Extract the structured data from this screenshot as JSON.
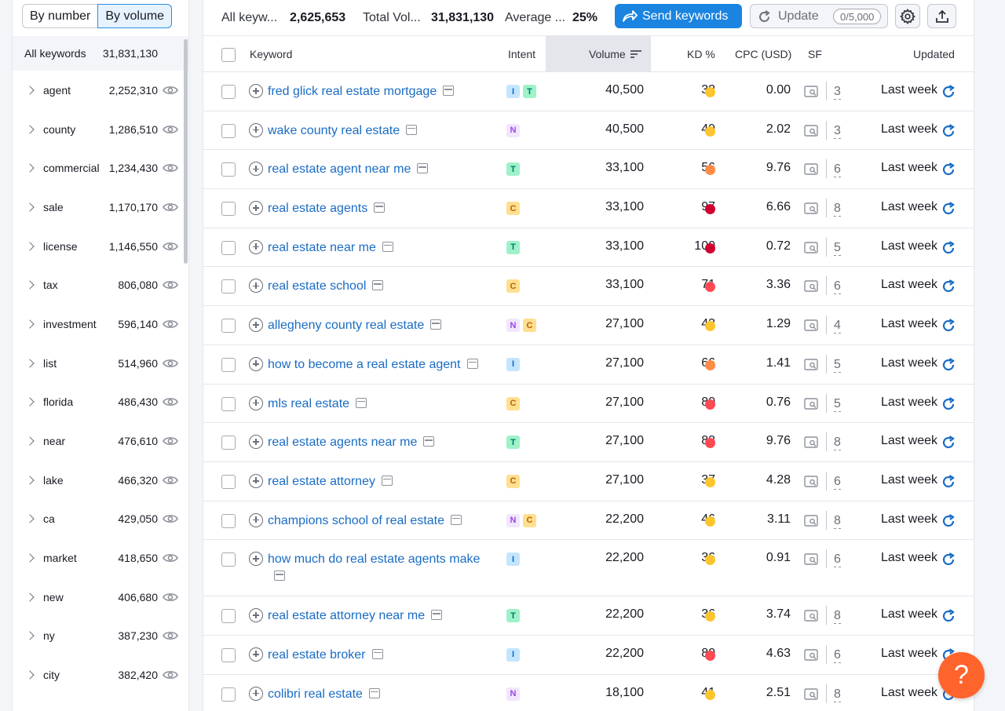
{
  "toggle": {
    "by_number": "By number",
    "by_volume": "By volume",
    "selected": "By volume"
  },
  "sidebar": {
    "all_label": "All keywords",
    "all_count": "31,831,130",
    "items": [
      {
        "name": "agent",
        "count": "2,252,310"
      },
      {
        "name": "county",
        "count": "1,286,510"
      },
      {
        "name": "commercial",
        "count": "1,234,430"
      },
      {
        "name": "sale",
        "count": "1,170,170"
      },
      {
        "name": "license",
        "count": "1,146,550"
      },
      {
        "name": "tax",
        "count": "806,080"
      },
      {
        "name": "investment",
        "count": "596,140"
      },
      {
        "name": "list",
        "count": "514,960"
      },
      {
        "name": "florida",
        "count": "486,430"
      },
      {
        "name": "near",
        "count": "476,610"
      },
      {
        "name": "lake",
        "count": "466,320"
      },
      {
        "name": "ca",
        "count": "429,050"
      },
      {
        "name": "market",
        "count": "418,650"
      },
      {
        "name": "new",
        "count": "406,680"
      },
      {
        "name": "ny",
        "count": "387,230"
      },
      {
        "name": "city",
        "count": "382,420"
      }
    ]
  },
  "topbar": {
    "all_kw_label": "All keyw...",
    "all_kw_value": "2,625,653",
    "total_vol_label": "Total Vol...",
    "total_vol_value": "31,831,130",
    "average_label": "Average ...",
    "average_value": "25%",
    "send_label": "Send keywords",
    "update_label": "Update",
    "update_quota": "0/5,000"
  },
  "columns": {
    "keyword": "Keyword",
    "intent": "Intent",
    "volume": "Volume",
    "kd": "KD %",
    "cpc": "CPC (USD)",
    "sf": "SF",
    "updated": "Updated"
  },
  "colors": {
    "kd_yellow": "#fcc52d",
    "kd_orange": "#ff8c43",
    "kd_red": "#ff4953",
    "kd_darkred": "#d1002f",
    "accent": "#1a84e0",
    "help": "#ff642d"
  },
  "rows": [
    {
      "keyword": "fred glick real estate mortgage",
      "intents": [
        "I",
        "T"
      ],
      "volume": "40,500",
      "kd": "32",
      "kd_color": "#fcc52d",
      "cpc": "0.00",
      "sf": "3",
      "updated": "Last week"
    },
    {
      "keyword": "wake county real estate",
      "intents": [
        "N"
      ],
      "volume": "40,500",
      "kd": "49",
      "kd_color": "#fcc52d",
      "cpc": "2.02",
      "sf": "3",
      "updated": "Last week"
    },
    {
      "keyword": "real estate agent near me",
      "intents": [
        "T"
      ],
      "volume": "33,100",
      "kd": "56",
      "kd_color": "#ff8c43",
      "cpc": "9.76",
      "sf": "6",
      "updated": "Last week"
    },
    {
      "keyword": "real estate agents",
      "intents": [
        "C"
      ],
      "volume": "33,100",
      "kd": "97",
      "kd_color": "#d1002f",
      "cpc": "6.66",
      "sf": "8",
      "updated": "Last week"
    },
    {
      "keyword": "real estate near me",
      "intents": [
        "T"
      ],
      "volume": "33,100",
      "kd": "100",
      "kd_color": "#d1002f",
      "cpc": "0.72",
      "sf": "5",
      "updated": "Last week"
    },
    {
      "keyword": "real estate school",
      "intents": [
        "C"
      ],
      "volume": "33,100",
      "kd": "71",
      "kd_color": "#ff4953",
      "cpc": "3.36",
      "sf": "6",
      "updated": "Last week"
    },
    {
      "keyword": "allegheny county real estate",
      "intents": [
        "N",
        "C"
      ],
      "volume": "27,100",
      "kd": "43",
      "kd_color": "#fcc52d",
      "cpc": "1.29",
      "sf": "4",
      "updated": "Last week"
    },
    {
      "keyword": "how to become a real estate agent",
      "intents": [
        "I"
      ],
      "volume": "27,100",
      "kd": "66",
      "kd_color": "#ff8c43",
      "cpc": "1.41",
      "sf": "5",
      "updated": "Last week"
    },
    {
      "keyword": "mls real estate",
      "intents": [
        "C"
      ],
      "volume": "27,100",
      "kd": "80",
      "kd_color": "#ff4953",
      "cpc": "0.76",
      "sf": "5",
      "updated": "Last week"
    },
    {
      "keyword": "real estate agents near me",
      "intents": [
        "T"
      ],
      "volume": "27,100",
      "kd": "83",
      "kd_color": "#ff4953",
      "cpc": "9.76",
      "sf": "8",
      "updated": "Last week"
    },
    {
      "keyword": "real estate attorney",
      "intents": [
        "C"
      ],
      "volume": "27,100",
      "kd": "37",
      "kd_color": "#fcc52d",
      "cpc": "4.28",
      "sf": "6",
      "updated": "Last week"
    },
    {
      "keyword": "champions school of real estate",
      "intents": [
        "N",
        "C"
      ],
      "volume": "22,200",
      "kd": "46",
      "kd_color": "#fcc52d",
      "cpc": "3.11",
      "sf": "8",
      "updated": "Last week"
    },
    {
      "keyword": "how much do real estate agents make",
      "intents": [
        "I"
      ],
      "volume": "22,200",
      "kd": "36",
      "kd_color": "#fcc52d",
      "cpc": "0.91",
      "sf": "6",
      "updated": "Last week",
      "tall": true
    },
    {
      "keyword": "real estate attorney near me",
      "intents": [
        "T"
      ],
      "volume": "22,200",
      "kd": "36",
      "kd_color": "#fcc52d",
      "cpc": "3.74",
      "sf": "8",
      "updated": "Last week"
    },
    {
      "keyword": "real estate broker",
      "intents": [
        "I"
      ],
      "volume": "22,200",
      "kd": "80",
      "kd_color": "#ff4953",
      "cpc": "4.63",
      "sf": "6",
      "updated": "Last week"
    },
    {
      "keyword": "colibri real estate",
      "intents": [
        "N"
      ],
      "volume": "18,100",
      "kd": "41",
      "kd_color": "#fcc52d",
      "cpc": "2.51",
      "sf": "8",
      "updated": "Last week"
    }
  ],
  "help_label": "?"
}
